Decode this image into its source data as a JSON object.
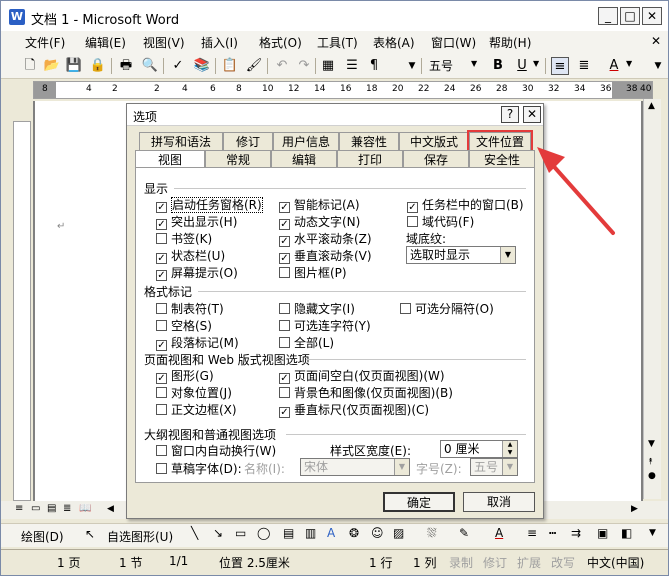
{
  "window": {
    "title": "文档 1 - Microsoft Word",
    "icon_letter": "W"
  },
  "menu": [
    "文件(F)",
    "编辑(E)",
    "视图(V)",
    "插入(I)",
    "格式(O)",
    "工具(T)",
    "表格(A)",
    "窗口(W)",
    "帮助(H)"
  ],
  "toolbar": {
    "font_size": "五号",
    "bold": "B",
    "underline": "U",
    "font_color": "A"
  },
  "ruler": {
    "numbers": [
      "8",
      "6",
      "4",
      "2",
      "",
      "2",
      "4",
      "6",
      "8",
      "10",
      "12",
      "14",
      "16",
      "18",
      "20",
      "22",
      "24",
      "26",
      "28",
      "30",
      "32",
      "34",
      "36",
      "38",
      "40"
    ]
  },
  "dialog": {
    "title": "选项",
    "help": "?",
    "close": "✕",
    "tabs_row1": [
      "拼写和语法",
      "修订",
      "用户信息",
      "兼容性",
      "中文版式",
      "文件位置"
    ],
    "tabs_row2": [
      "视图",
      "常规",
      "编辑",
      "打印",
      "保存",
      "安全性"
    ],
    "sections": {
      "display": "显示",
      "format_marks": "格式标记",
      "page_view": "页面视图和 Web 版式视图选项",
      "outline": "大纲视图和普通视图选项"
    },
    "display": [
      {
        "label": "启动任务窗格(R)",
        "checked": true
      },
      {
        "label": "突出显示(H)",
        "checked": true
      },
      {
        "label": "书签(K)",
        "checked": false
      },
      {
        "label": "状态栏(U)",
        "checked": true
      },
      {
        "label": "屏幕提示(O)",
        "checked": true
      },
      {
        "label": "智能标记(A)",
        "checked": true
      },
      {
        "label": "动态文字(N)",
        "checked": true
      },
      {
        "label": "水平滚动条(Z)",
        "checked": true
      },
      {
        "label": "垂直滚动条(V)",
        "checked": true
      },
      {
        "label": "图片框(P)",
        "checked": false
      },
      {
        "label": "任务栏中的窗口(B)",
        "checked": true
      },
      {
        "label": "域代码(F)",
        "checked": false
      }
    ],
    "field_shading_label": "域底纹:",
    "field_shading_value": "选取时显示",
    "format_marks": [
      {
        "label": "制表符(T)",
        "checked": false
      },
      {
        "label": "空格(S)",
        "checked": false
      },
      {
        "label": "段落标记(M)",
        "checked": true
      },
      {
        "label": "隐藏文字(I)",
        "checked": false
      },
      {
        "label": "可选连字符(Y)",
        "checked": false
      },
      {
        "label": "全部(L)",
        "checked": false
      },
      {
        "label": "可选分隔符(O)",
        "checked": false
      }
    ],
    "page_view": [
      {
        "label": "图形(G)",
        "checked": true
      },
      {
        "label": "对象位置(J)",
        "checked": false
      },
      {
        "label": "正文边框(X)",
        "checked": false
      },
      {
        "label": "页面间空白(仅页面视图)(W)",
        "checked": true
      },
      {
        "label": "背景色和图像(仅页面视图)(B)",
        "checked": false
      },
      {
        "label": "垂直标尺(仅页面视图)(C)",
        "checked": true
      }
    ],
    "outline": {
      "wrap": "窗口内自动换行(W)",
      "draft_font": "草稿字体(D):",
      "name_label": "名称(I):",
      "name_value": "宋体",
      "size_label": "字号(Z):",
      "size_value": "五号",
      "style_width_label": "样式区宽度(E):",
      "style_width_value": "0 厘米"
    },
    "ok": "确定",
    "cancel": "取消"
  },
  "drawbar": {
    "draw": "绘图(D)",
    "autoshapes": "自选图形(U)"
  },
  "status": {
    "page": "1 页",
    "section": "1 节",
    "pages": "1/1",
    "position": "位置 2.5厘米",
    "line": "1 行",
    "col": "1 列",
    "rec": "录制",
    "trk": "修订",
    "ext": "扩展",
    "ovr": "改写",
    "lang": "中文(中国)"
  },
  "colors": {
    "highlight": "#e33b3b",
    "title_icon": "#2b5fc4"
  }
}
